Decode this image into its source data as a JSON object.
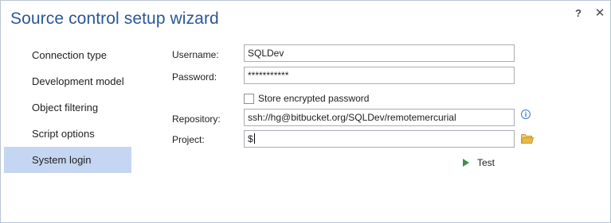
{
  "window": {
    "title": "Source control setup wizard",
    "help_label": "?",
    "close_label": "✕"
  },
  "nav": {
    "items": [
      {
        "label": "Connection type",
        "selected": false
      },
      {
        "label": "Development model",
        "selected": false
      },
      {
        "label": "Object filtering",
        "selected": false
      },
      {
        "label": "Script options",
        "selected": false
      },
      {
        "label": "System login",
        "selected": true
      }
    ]
  },
  "form": {
    "username_label": "Username:",
    "username_value": "SQLDev",
    "password_label": "Password:",
    "password_value": "***********",
    "store_password_label": "Store encrypted password",
    "store_password_checked": false,
    "repository_label": "Repository:",
    "repository_value": "ssh://hg@bitbucket.org/SQLDev/remotemercurial",
    "project_label": "Project:",
    "project_value": "$"
  },
  "actions": {
    "test_label": "Test"
  },
  "icons": {
    "info": "info-icon",
    "folder": "folder-icon",
    "play": "play-icon"
  },
  "colors": {
    "title": "#2b5797",
    "nav_selected": "#c5d6f2",
    "play": "#3c8f52",
    "info": "#3a7bd5",
    "folder": "#e8b84a"
  }
}
